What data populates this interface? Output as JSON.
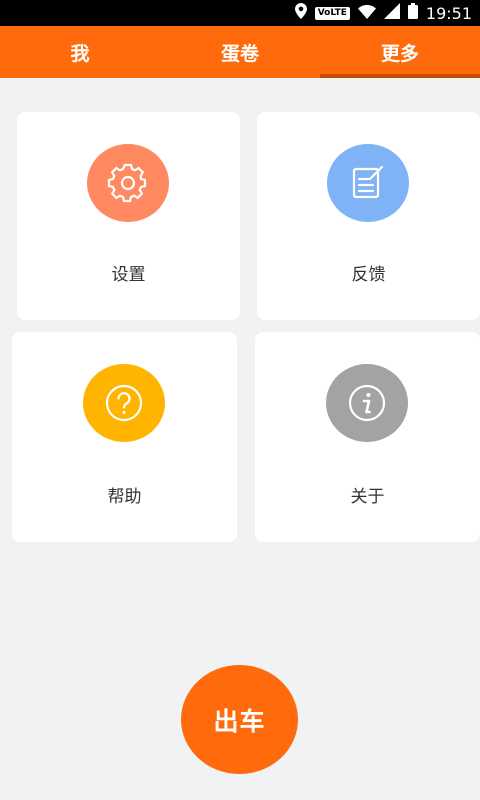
{
  "status_bar": {
    "time": "19:51",
    "network_badge": "VoLTE"
  },
  "tabs": [
    {
      "label": "我",
      "active": false
    },
    {
      "label": "蛋卷",
      "active": false
    },
    {
      "label": "更多",
      "active": true
    }
  ],
  "grid": {
    "settings": {
      "label": "设置",
      "icon": "gear-icon",
      "color": "#ff8a61"
    },
    "feedback": {
      "label": "反馈",
      "icon": "edit-note-icon",
      "color": "#7fb3f6"
    },
    "help": {
      "label": "帮助",
      "icon": "question-icon",
      "color": "#ffb400"
    },
    "about": {
      "label": "关于",
      "icon": "info-icon",
      "color": "#a3a3a3"
    }
  },
  "fab": {
    "label": "出车",
    "color": "#ff6a0c"
  }
}
